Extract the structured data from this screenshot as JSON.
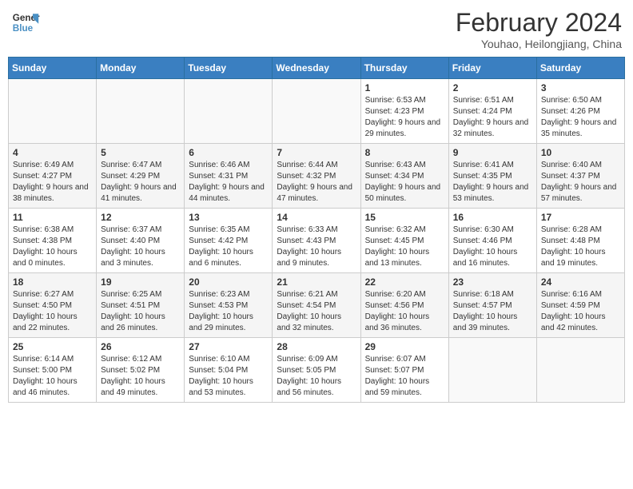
{
  "header": {
    "logo_line1": "General",
    "logo_line2": "Blue",
    "month": "February 2024",
    "location": "Youhao, Heilongjiang, China"
  },
  "days_of_week": [
    "Sunday",
    "Monday",
    "Tuesday",
    "Wednesday",
    "Thursday",
    "Friday",
    "Saturday"
  ],
  "weeks": [
    [
      {
        "day": "",
        "text": ""
      },
      {
        "day": "",
        "text": ""
      },
      {
        "day": "",
        "text": ""
      },
      {
        "day": "",
        "text": ""
      },
      {
        "day": "1",
        "text": "Sunrise: 6:53 AM\nSunset: 4:23 PM\nDaylight: 9 hours and 29 minutes."
      },
      {
        "day": "2",
        "text": "Sunrise: 6:51 AM\nSunset: 4:24 PM\nDaylight: 9 hours and 32 minutes."
      },
      {
        "day": "3",
        "text": "Sunrise: 6:50 AM\nSunset: 4:26 PM\nDaylight: 9 hours and 35 minutes."
      }
    ],
    [
      {
        "day": "4",
        "text": "Sunrise: 6:49 AM\nSunset: 4:27 PM\nDaylight: 9 hours and 38 minutes."
      },
      {
        "day": "5",
        "text": "Sunrise: 6:47 AM\nSunset: 4:29 PM\nDaylight: 9 hours and 41 minutes."
      },
      {
        "day": "6",
        "text": "Sunrise: 6:46 AM\nSunset: 4:31 PM\nDaylight: 9 hours and 44 minutes."
      },
      {
        "day": "7",
        "text": "Sunrise: 6:44 AM\nSunset: 4:32 PM\nDaylight: 9 hours and 47 minutes."
      },
      {
        "day": "8",
        "text": "Sunrise: 6:43 AM\nSunset: 4:34 PM\nDaylight: 9 hours and 50 minutes."
      },
      {
        "day": "9",
        "text": "Sunrise: 6:41 AM\nSunset: 4:35 PM\nDaylight: 9 hours and 53 minutes."
      },
      {
        "day": "10",
        "text": "Sunrise: 6:40 AM\nSunset: 4:37 PM\nDaylight: 9 hours and 57 minutes."
      }
    ],
    [
      {
        "day": "11",
        "text": "Sunrise: 6:38 AM\nSunset: 4:38 PM\nDaylight: 10 hours and 0 minutes."
      },
      {
        "day": "12",
        "text": "Sunrise: 6:37 AM\nSunset: 4:40 PM\nDaylight: 10 hours and 3 minutes."
      },
      {
        "day": "13",
        "text": "Sunrise: 6:35 AM\nSunset: 4:42 PM\nDaylight: 10 hours and 6 minutes."
      },
      {
        "day": "14",
        "text": "Sunrise: 6:33 AM\nSunset: 4:43 PM\nDaylight: 10 hours and 9 minutes."
      },
      {
        "day": "15",
        "text": "Sunrise: 6:32 AM\nSunset: 4:45 PM\nDaylight: 10 hours and 13 minutes."
      },
      {
        "day": "16",
        "text": "Sunrise: 6:30 AM\nSunset: 4:46 PM\nDaylight: 10 hours and 16 minutes."
      },
      {
        "day": "17",
        "text": "Sunrise: 6:28 AM\nSunset: 4:48 PM\nDaylight: 10 hours and 19 minutes."
      }
    ],
    [
      {
        "day": "18",
        "text": "Sunrise: 6:27 AM\nSunset: 4:50 PM\nDaylight: 10 hours and 22 minutes."
      },
      {
        "day": "19",
        "text": "Sunrise: 6:25 AM\nSunset: 4:51 PM\nDaylight: 10 hours and 26 minutes."
      },
      {
        "day": "20",
        "text": "Sunrise: 6:23 AM\nSunset: 4:53 PM\nDaylight: 10 hours and 29 minutes."
      },
      {
        "day": "21",
        "text": "Sunrise: 6:21 AM\nSunset: 4:54 PM\nDaylight: 10 hours and 32 minutes."
      },
      {
        "day": "22",
        "text": "Sunrise: 6:20 AM\nSunset: 4:56 PM\nDaylight: 10 hours and 36 minutes."
      },
      {
        "day": "23",
        "text": "Sunrise: 6:18 AM\nSunset: 4:57 PM\nDaylight: 10 hours and 39 minutes."
      },
      {
        "day": "24",
        "text": "Sunrise: 6:16 AM\nSunset: 4:59 PM\nDaylight: 10 hours and 42 minutes."
      }
    ],
    [
      {
        "day": "25",
        "text": "Sunrise: 6:14 AM\nSunset: 5:00 PM\nDaylight: 10 hours and 46 minutes."
      },
      {
        "day": "26",
        "text": "Sunrise: 6:12 AM\nSunset: 5:02 PM\nDaylight: 10 hours and 49 minutes."
      },
      {
        "day": "27",
        "text": "Sunrise: 6:10 AM\nSunset: 5:04 PM\nDaylight: 10 hours and 53 minutes."
      },
      {
        "day": "28",
        "text": "Sunrise: 6:09 AM\nSunset: 5:05 PM\nDaylight: 10 hours and 56 minutes."
      },
      {
        "day": "29",
        "text": "Sunrise: 6:07 AM\nSunset: 5:07 PM\nDaylight: 10 hours and 59 minutes."
      },
      {
        "day": "",
        "text": ""
      },
      {
        "day": "",
        "text": ""
      }
    ]
  ]
}
